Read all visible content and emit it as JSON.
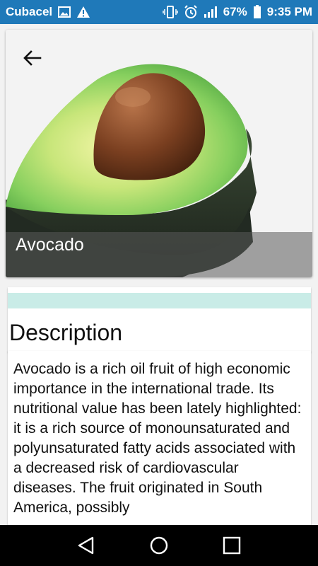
{
  "status_bar": {
    "carrier": "Cubacel",
    "battery": "67%",
    "time": "9:35 PM"
  },
  "hero": {
    "title": "Avocado",
    "back_icon": "arrow-left-icon"
  },
  "description": {
    "heading": "Description",
    "body": "Avocado is a rich oil fruit of high economic importance in the international trade. Its nutritional value has been lately highlighted: it is a rich source of monounsaturated and polyunsaturated fatty acids associated with a decreased risk of cardiovascular diseases. The fruit originated in South America, possibly"
  },
  "nav": {
    "back_icon": "nav-back-icon",
    "home_icon": "nav-home-icon",
    "recents_icon": "nav-recents-icon"
  },
  "colors": {
    "status_bar": "#1f79b9",
    "accent": "#c9ece7"
  }
}
